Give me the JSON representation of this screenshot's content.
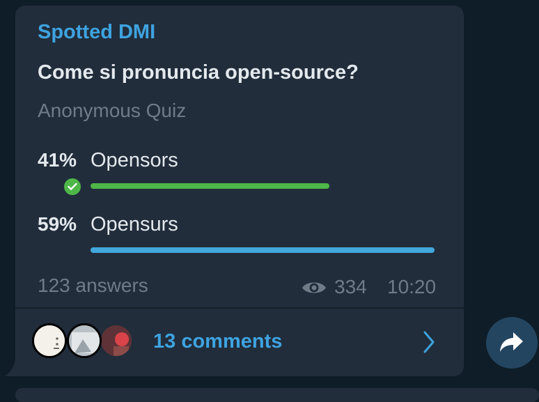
{
  "message": {
    "channel_name": "Spotted DMI",
    "question": "Come si pronuncia open-source?",
    "quiz_type": "Anonymous Quiz",
    "options": [
      {
        "percent": "41%",
        "label": "Opensors",
        "fraction": 0.41,
        "correct": true,
        "bar_color": "#4eb748"
      },
      {
        "percent": "59%",
        "label": "Opensurs",
        "fraction": 0.59,
        "correct": false,
        "bar_color": "#42a8dc"
      }
    ],
    "answers": "123 answers",
    "views": "334",
    "time": "10:20"
  },
  "comments": {
    "label": "13 comments"
  },
  "icons": {
    "check": "check-icon",
    "views": "eye-icon",
    "comments_arrow": "chevron-right-icon",
    "share": "share-arrow-icon"
  },
  "colors": {
    "accent": "#3ea3e0",
    "bubble": "#212d3b",
    "background": "#0e1d27",
    "correct": "#4eb748"
  }
}
